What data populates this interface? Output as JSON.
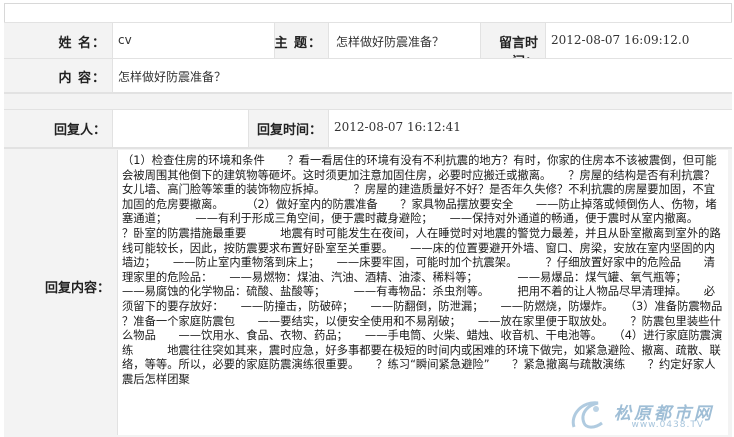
{
  "header": {
    "name_label": "姓 名：",
    "name_value": "cv",
    "subject_label": "主 题：",
    "subject_value": "怎样做好防震准备？",
    "time_label": "留言时间：",
    "time_value": "2012-08-07 16:09:12.0"
  },
  "message": {
    "content_label": "内 容：",
    "content_value": "怎样做好防震准备？"
  },
  "reply": {
    "person_label": "回复人：",
    "person_value": "",
    "time_label": "回复时间：",
    "time_value": "2012-08-07 16:12:41",
    "content_label": "回复内容：",
    "content_value": "（1）检查住房的环境和条件　　？看一看居住的环境有没有不利抗震的地方？有时，你家的住房本不该被震倒，但可能会被周围其他倒下的建筑物等砸坏。这时须更加注意加固住房，必要时应搬迁或撤离。　　？房屋的结构是否有利抗震？女儿墙、高门脸等笨重的装饰物应拆掉。　　　？房屋的建造质量好不好？是否年久失修？不利抗震的房屋要加固，不宜加固的危房要撤离。　　　（2）做好室内的防震准备　　？家具物品摆放要安全　　——防止掉落或倾倒伤人、伤物，堵塞通道；　　　——有利于形成三角空间，便于震时藏身避险；　　——保持对外通道的畅通，便于震时从室内撤离。　　　？卧室的防震措施最重要　　　地震有时可能发生在夜间，人在睡觉时对地震的警觉力最差，并且从卧室撤离到室外的路线可能较长，因此，按防震要求布置好卧室至关重要。　　——床的位置要避开外墙、窗口、房梁，安放在室内坚固的内墙边；　　——防止室内重物落到床上；　　——床要牢固，可能时加个抗震架。　　　？仔细放置好家中的危险品　　清理家里的危险品：　　——易燃物：煤油、汽油、酒精、油漆、稀料等；　　　　——易爆品：煤气罐、氧气瓶等；　　——易腐蚀的化学物品：硫酸、盐酸等；　　　——有毒物品：杀虫剂等。　　　把用不着的让人物品尽早清理掉。　　必须留下的要存放好：　　——防撞击，防破碎；　　——防翻倒，防泄漏；　　——防燃烧，防爆炸。　　（3）准备防震物品　　？准备一个家庭防震包　　——要结实，以便安全使用和不易剐破；　　——放在家里便于取放处。　　？防震包里装些什么物品　　——饮用水、食品、衣物、药品；　　——手电筒、火柴、蜡烛、收音机、干电池等。　　（4）进行家庭防震演练　　　地震往往突如其来，震时应急，好多事都要在极短的时间内或困难的环境下做完，如紧急避险、撤离、疏散、联络，等等。所以，必要的家庭防震演练很重要。　　？练习“瞬间紧急避险”　　？紧急撤离与疏散演练　　？约定好家人震后怎样团聚"
  },
  "watermark": {
    "logo_text": "松原都市网",
    "url_text": "www.0438.TV"
  }
}
